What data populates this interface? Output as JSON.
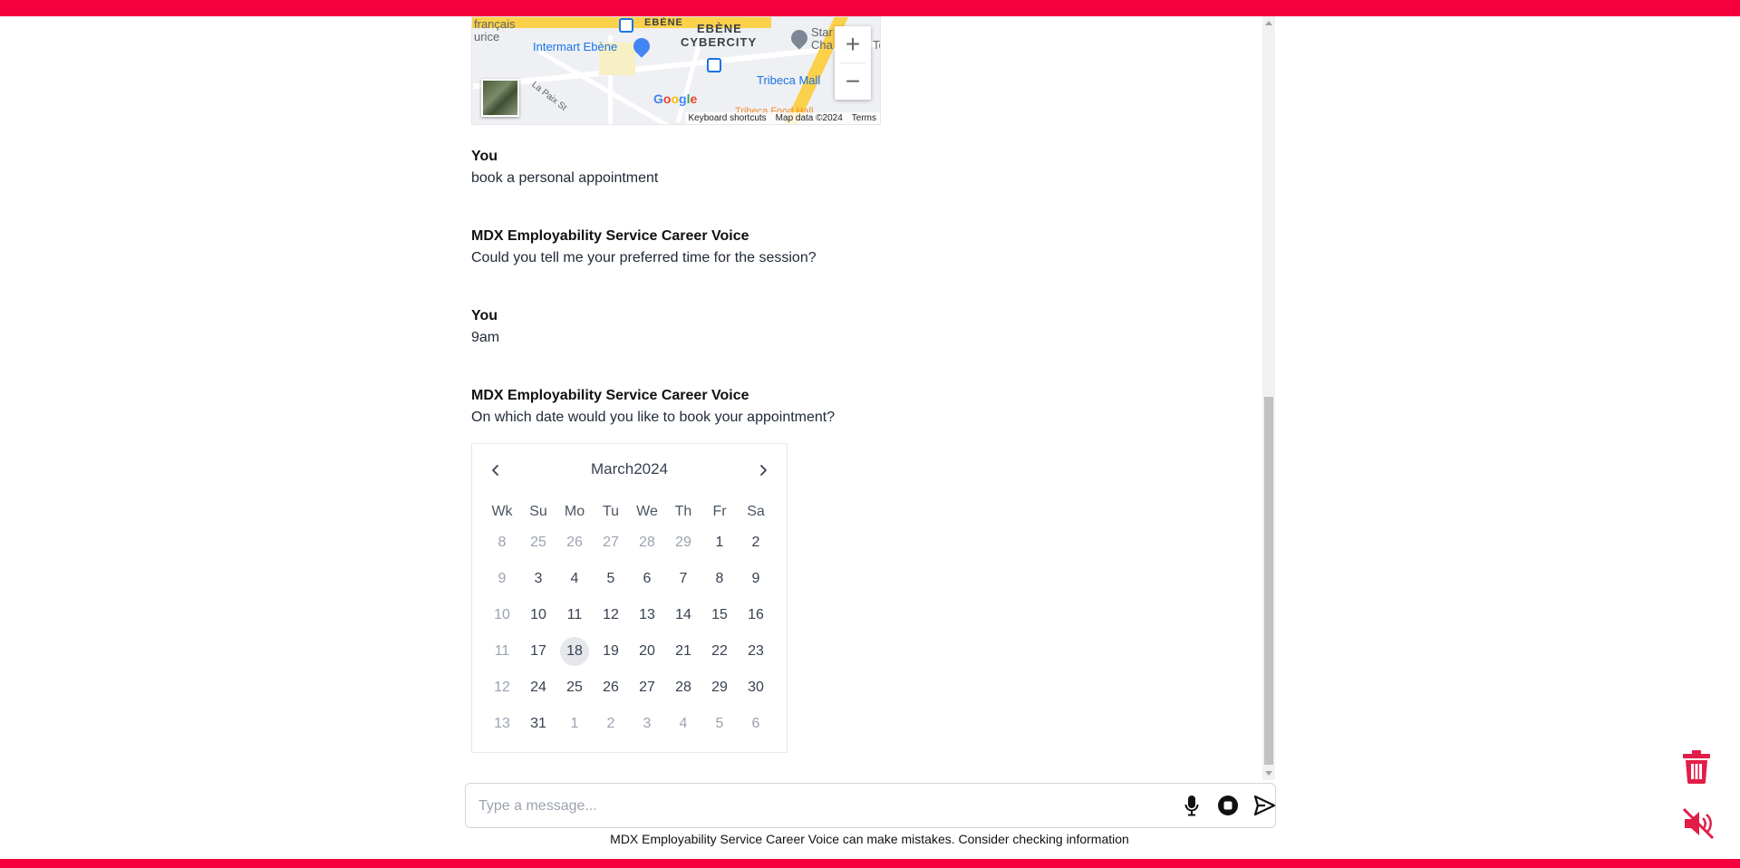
{
  "map": {
    "labels": {
      "francais": "français",
      "urice": "urice",
      "ebene_top": "EBÈNE",
      "ebene": "EBÈNE",
      "cybercity": "CYBERCITY",
      "intermart": "Intermart Ebène",
      "star": "Star",
      "cha": "Cha",
      "te": "Te",
      "tribeca": "Tribeca Mall",
      "la_paix": "La Paix St",
      "food_hall": "Tribeca Food Hall"
    },
    "google": "Google",
    "attribution": {
      "shortcuts": "Keyboard shortcuts",
      "map_data": "Map data ©2024",
      "terms": "Terms"
    },
    "zoom_in": "+",
    "zoom_out": "−"
  },
  "messages": [
    {
      "author": "You",
      "text": "book a personal appointment"
    },
    {
      "author": "MDX Employability Service Career Voice",
      "text": "Could you tell me your preferred time for the session?"
    },
    {
      "author": "You",
      "text": "9am"
    },
    {
      "author": "MDX Employability Service Career Voice",
      "text": "On which date would you like to book your appointment?"
    }
  ],
  "calendar": {
    "month": "March",
    "year": "2024",
    "headers": [
      "Wk",
      "Su",
      "Mo",
      "Tu",
      "We",
      "Th",
      "Fr",
      "Sa"
    ],
    "selected": "18",
    "weeks": [
      {
        "wk": "8",
        "days": [
          "25",
          "26",
          "27",
          "28",
          "29",
          "1",
          "2"
        ],
        "muted": [
          true,
          true,
          true,
          true,
          true,
          false,
          false
        ]
      },
      {
        "wk": "9",
        "days": [
          "3",
          "4",
          "5",
          "6",
          "7",
          "8",
          "9"
        ],
        "muted": [
          false,
          false,
          false,
          false,
          false,
          false,
          false
        ]
      },
      {
        "wk": "10",
        "days": [
          "10",
          "11",
          "12",
          "13",
          "14",
          "15",
          "16"
        ],
        "muted": [
          false,
          false,
          false,
          false,
          false,
          false,
          false
        ]
      },
      {
        "wk": "11",
        "days": [
          "17",
          "18",
          "19",
          "20",
          "21",
          "22",
          "23"
        ],
        "muted": [
          false,
          false,
          false,
          false,
          false,
          false,
          false
        ]
      },
      {
        "wk": "12",
        "days": [
          "24",
          "25",
          "26",
          "27",
          "28",
          "29",
          "30"
        ],
        "muted": [
          false,
          false,
          false,
          false,
          false,
          false,
          false
        ]
      },
      {
        "wk": "13",
        "days": [
          "31",
          "1",
          "2",
          "3",
          "4",
          "5",
          "6"
        ],
        "muted": [
          false,
          true,
          true,
          true,
          true,
          true,
          true
        ]
      }
    ]
  },
  "input": {
    "placeholder": "Type a message...",
    "value": ""
  },
  "disclaimer": "MDX Employability Service Career Voice can make mistakes. Consider checking information",
  "colors": {
    "brand": "#f5003d",
    "accent_red": "#e11d48",
    "selected_day_bg": "#e5e7eb"
  },
  "icons": {
    "mic": "microphone-icon",
    "stop": "stop-icon",
    "send": "send-icon",
    "trash": "trash-icon",
    "mute": "speaker-muted-icon"
  }
}
